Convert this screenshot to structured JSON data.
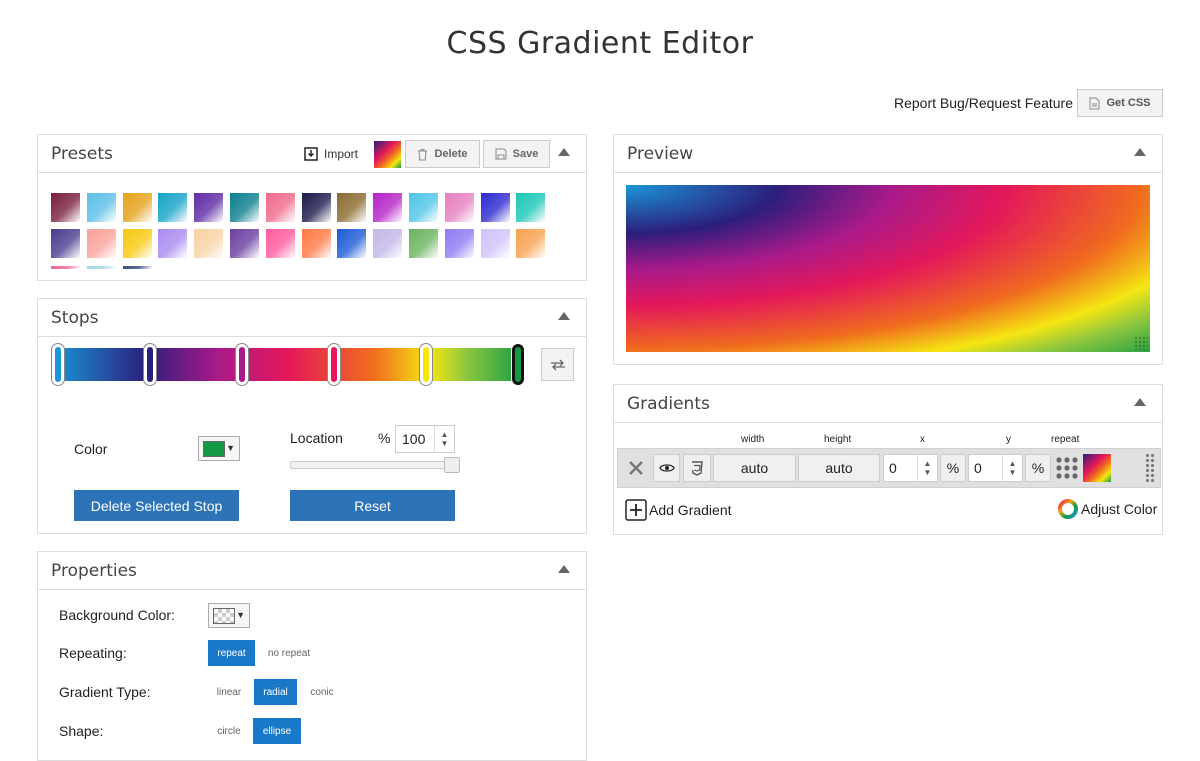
{
  "app": {
    "title": "CSS Gradient Editor",
    "report_link": "Report Bug/Request Feature",
    "get_css": "Get CSS"
  },
  "presets": {
    "title": "Presets",
    "import": "Import",
    "delete": "Delete",
    "save": "Save",
    "current_swatch_colors": [
      "#1a96d8",
      "#e4185a",
      "#f5e612",
      "#149a45"
    ],
    "swatch_colors": [
      [
        "#7a1f3d",
        "#5bbfe6",
        "#e5a21c",
        "#17a3c7",
        "#5e2ca5",
        "#0b7f8e",
        "#f06a8c",
        "#1b1b4d",
        "#8a6b30",
        "#b623c8",
        "#4fc4e8",
        "#e680c0",
        "#2d2ad0",
        "#1cc7b7"
      ],
      [
        "#4a3d8f",
        "#f9a19a",
        "#f6c90e",
        "#a98bf0",
        "#f7d2a3",
        "#6b3fa0",
        "#ff5b9e",
        "#ff7a45",
        "#1e5ad6",
        "#c3b7e8",
        "#6bb35f",
        "#8f7bf2",
        "#d0c2fb",
        "#f7a24f"
      ],
      [
        "#f06292",
        "#9ed8e8",
        "#3a4a8a"
      ]
    ]
  },
  "stops": {
    "title": "Stops",
    "color_label": "Color",
    "selected_color": "#149a45",
    "location_label": "Location",
    "percent_sign": "%",
    "location_value": "100",
    "location_fraction": 1.0,
    "handles": [
      {
        "color": "#1a96d8",
        "selected": false
      },
      {
        "color": "#2c1e7c",
        "selected": false
      },
      {
        "color": "#a91a8a",
        "selected": false
      },
      {
        "color": "#e4185a",
        "selected": false
      },
      {
        "color": "#f5e612",
        "selected": false
      },
      {
        "color": "#149a45",
        "selected": true
      }
    ],
    "delete_button": "Delete Selected Stop",
    "reset_button": "Reset"
  },
  "properties": {
    "title": "Properties",
    "background_color_label": "Background Color:",
    "repeating_label": "Repeating:",
    "repeating_options": [
      "repeat",
      "no repeat"
    ],
    "repeating_selected": "repeat",
    "gradient_type_label": "Gradient Type:",
    "gradient_type_options": [
      "linear",
      "radial",
      "conic"
    ],
    "gradient_type_selected": "radial",
    "shape_label": "Shape:",
    "shape_options": [
      "circle",
      "ellipse"
    ],
    "shape_selected": "ellipse"
  },
  "preview": {
    "title": "Preview"
  },
  "gradients": {
    "title": "Gradients",
    "columns": {
      "width": "width",
      "height": "height",
      "x": "x",
      "y": "y",
      "repeat": "repeat"
    },
    "row": {
      "width": "auto",
      "height": "auto",
      "x": "0",
      "x_unit": "%",
      "y": "0",
      "y_unit": "%"
    },
    "add_gradient": "Add Gradient",
    "adjust_color": "Adjust Color"
  },
  "icons": [
    "document-icon",
    "import-icon",
    "trash-icon",
    "floppy-disk-icon",
    "collapse-arrow-icon",
    "swap-arrows-icon",
    "close-x-icon",
    "eye-icon",
    "css3-icon",
    "dot-grid-icon",
    "drag-handle-icon",
    "plus-box-icon",
    "color-wheel-icon",
    "chevron-down-icon",
    "spinner-arrows-icon"
  ]
}
